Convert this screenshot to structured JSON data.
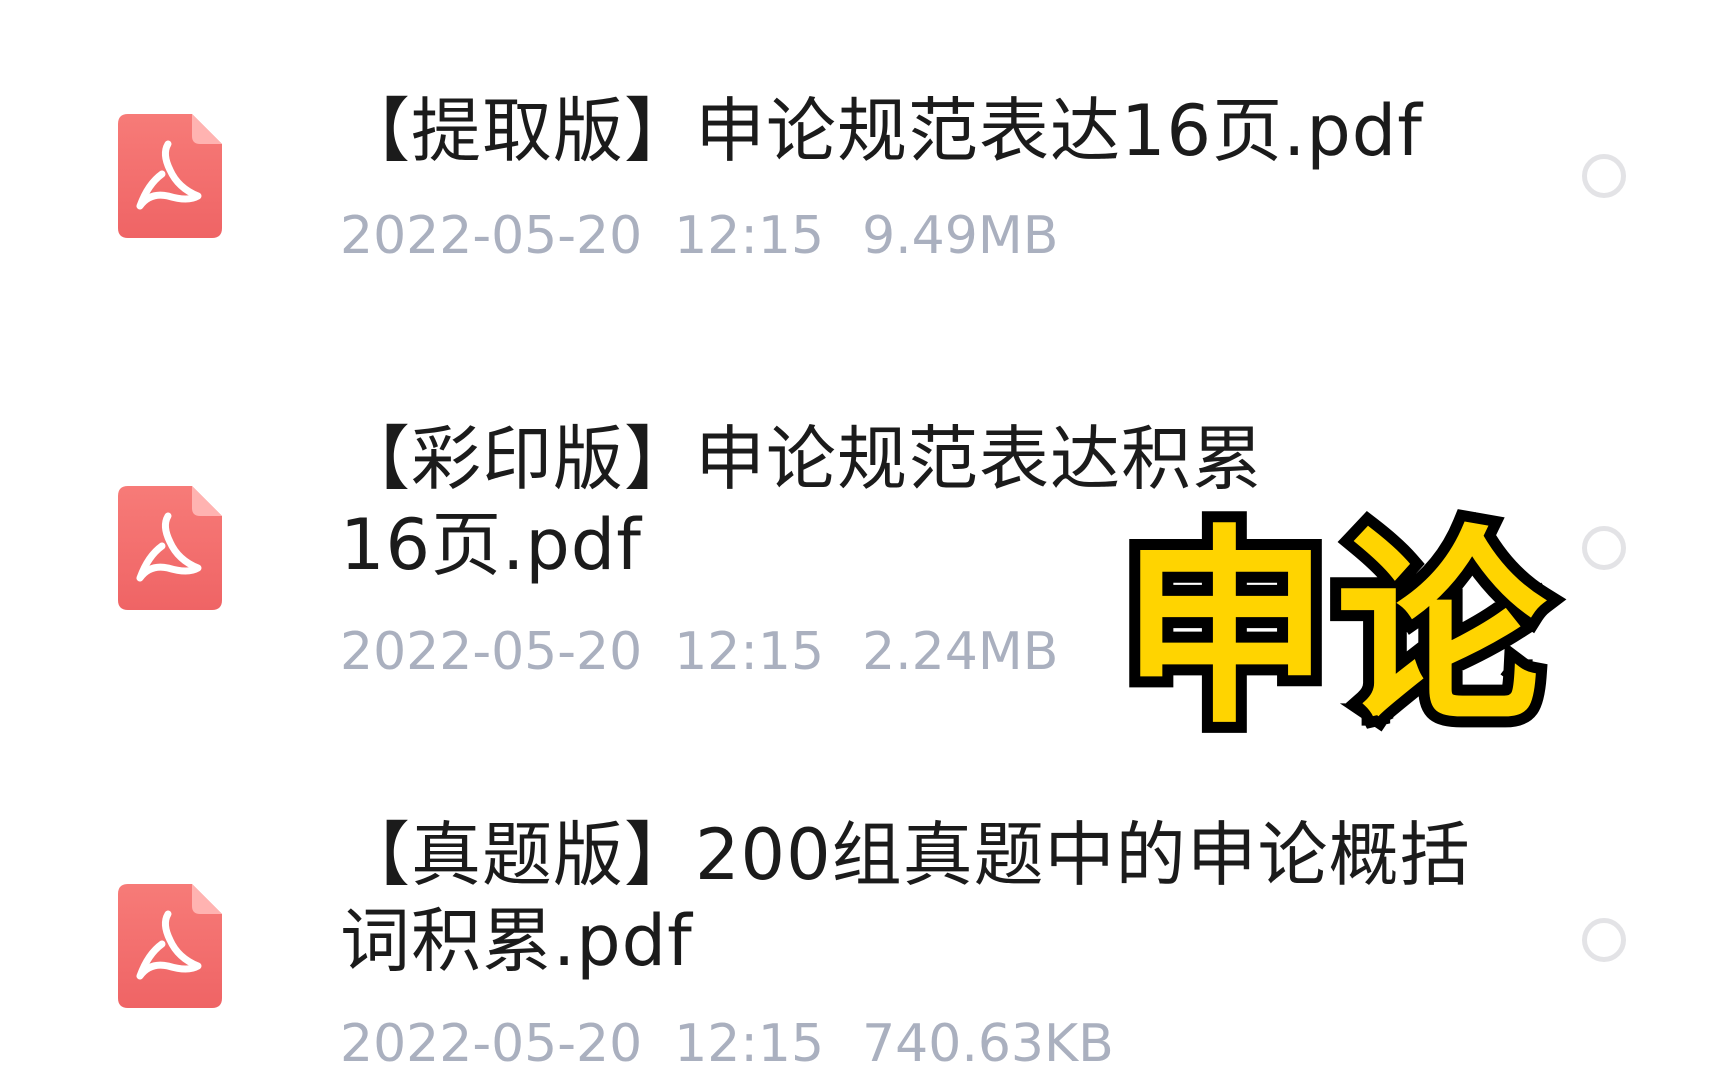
{
  "files": [
    {
      "name": "【提取版】申论规范表达16页.pdf",
      "date": "2022-05-20",
      "time": "12:15",
      "size": "9.49MB",
      "icon": "pdf-file-icon"
    },
    {
      "name": "【彩印版】申论规范表达积累16页.pdf",
      "date": "2022-05-20",
      "time": "12:15",
      "size": "2.24MB",
      "icon": "pdf-file-icon"
    },
    {
      "name": "【真题版】200组真题中的申论概括词积累.pdf",
      "date": "2022-05-20",
      "time": "12:15",
      "size": "740.63KB",
      "icon": "pdf-file-icon"
    }
  ],
  "overlay": {
    "caption": "申论"
  },
  "colors": {
    "pdf_icon": "#f26e6e",
    "name_text": "#1b1b1b",
    "meta_text": "#aab0bf",
    "radio_border": "#e3e3e6",
    "caption_fill": "#ffd400",
    "caption_stroke": "#000000"
  }
}
